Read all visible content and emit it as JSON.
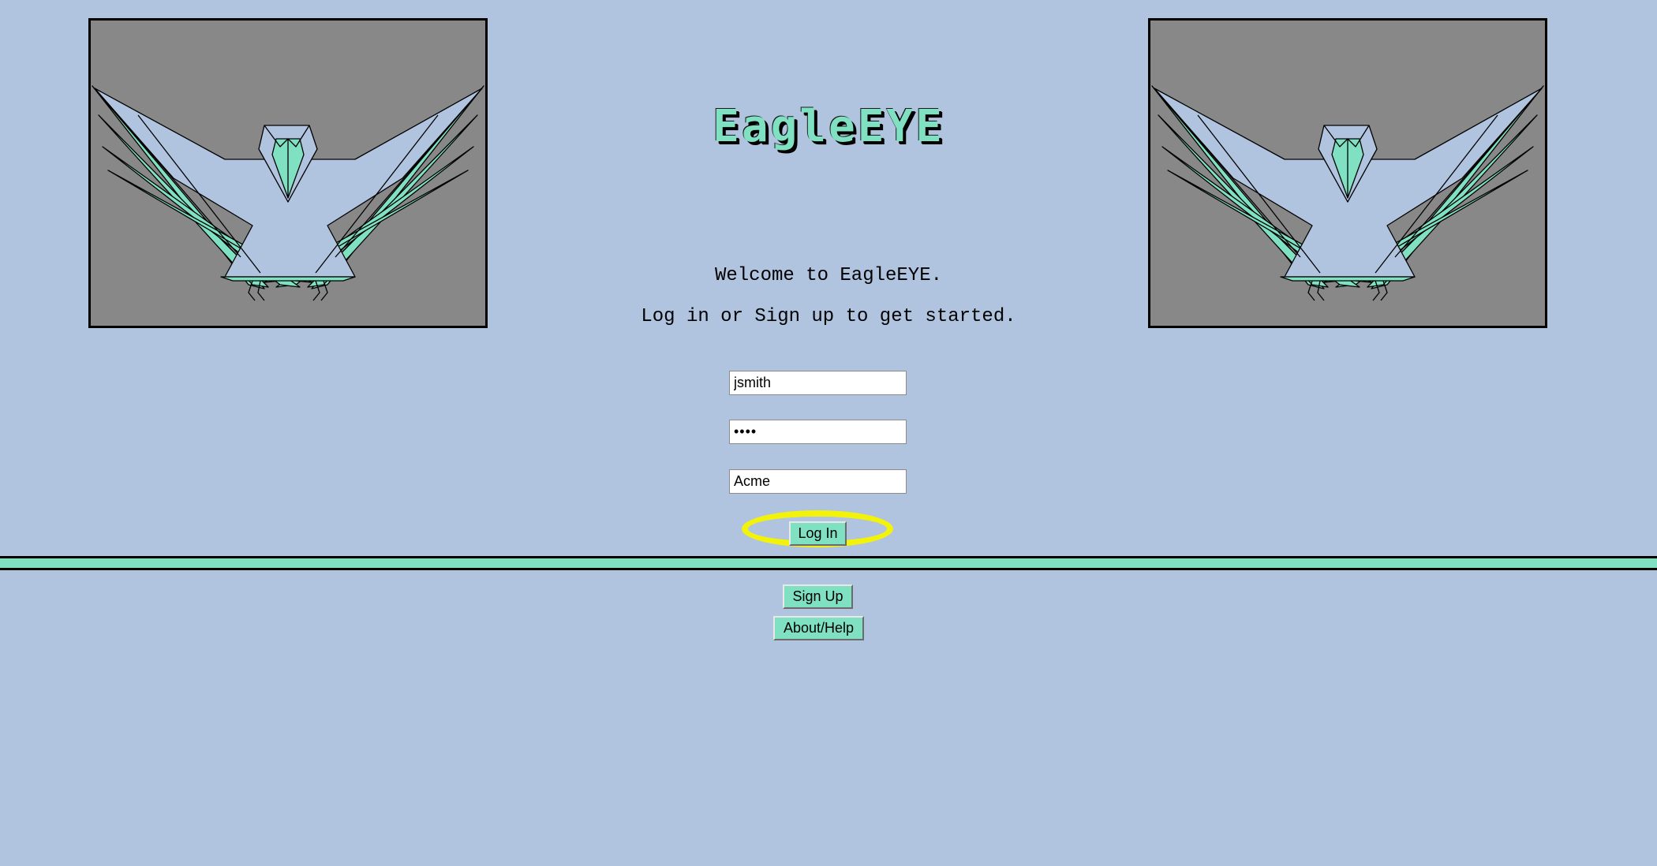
{
  "app": {
    "title": "EagleEYE"
  },
  "welcome": {
    "line1": "Welcome to EagleEYE.",
    "line2": "Log in or Sign up to get started."
  },
  "login_form": {
    "username_value": "jsmith",
    "password_value": "••••",
    "organization_value": "Acme",
    "login_label": "Log In"
  },
  "footer_nav": {
    "signup_label": "Sign Up",
    "about_label": "About/Help"
  },
  "images": {
    "left_logo": "eagle-logo",
    "right_logo": "eagle-logo"
  },
  "colors": {
    "background": "#b0c4df",
    "accent": "#7fe0c2",
    "panel": "#888888",
    "highlight": "#f2f20a"
  }
}
